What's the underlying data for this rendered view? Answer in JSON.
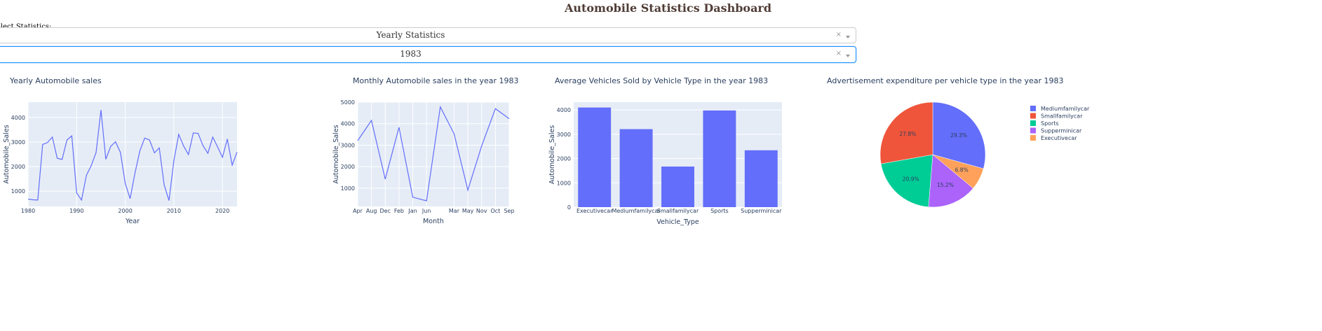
{
  "header": {
    "title": "Automobile Statistics Dashboard"
  },
  "controls": {
    "select_label": "elect Statistics:",
    "stat_dropdown": {
      "value": "Yearly Statistics",
      "clear": "×"
    },
    "year_dropdown": {
      "value": "1983",
      "clear": "×"
    }
  },
  "chart_data": [
    {
      "type": "line",
      "title": "Yearly Automobile sales",
      "xlabel": "Year",
      "ylabel": "Automobile_Sales",
      "xlim": [
        1980,
        2023
      ],
      "ylim": [
        380,
        4620
      ],
      "xticks": [
        "1980",
        "1990",
        "2000",
        "2010",
        "2020"
      ],
      "yticks": [
        "1000",
        "2000",
        "3000",
        "4000"
      ],
      "x": [
        1980,
        1981,
        1982,
        1983,
        1984,
        1985,
        1986,
        1987,
        1988,
        1989,
        1990,
        1991,
        1992,
        1993,
        1994,
        1995,
        1996,
        1997,
        1998,
        1999,
        2000,
        2001,
        2002,
        2003,
        2004,
        2005,
        2006,
        2007,
        2008,
        2009,
        2010,
        2011,
        2012,
        2013,
        2014,
        2015,
        2016,
        2017,
        2018,
        2019,
        2020,
        2021,
        2022,
        2023
      ],
      "values": [
        680,
        650,
        640,
        2900,
        2980,
        3200,
        2340,
        2290,
        3080,
        3250,
        930,
        640,
        1640,
        2040,
        2580,
        4300,
        2300,
        2820,
        3010,
        2580,
        1310,
        700,
        1740,
        2640,
        3160,
        3080,
        2560,
        2760,
        1260,
        620,
        2240,
        3310,
        2840,
        2490,
        3370,
        3350,
        2850,
        2540,
        3200,
        2800,
        2380,
        3120,
        2060,
        2590
      ]
    },
    {
      "type": "line",
      "title": "Monthly Automobile sales in the year 1983",
      "xlabel": "Month",
      "ylabel": "Automobile_Sales",
      "categories": [
        "Apr",
        "Aug",
        "Dec",
        "Feb",
        "Jan",
        "Jun",
        "Mar",
        "May",
        "Nov",
        "Oct",
        "Sep"
      ],
      "ylim": [
        150,
        5000
      ],
      "yticks": [
        "1000",
        "2000",
        "3000",
        "4000",
        "5000"
      ],
      "values": [
        3210,
        4150,
        1420,
        3830,
        580,
        410,
        4780,
        3530,
        910,
        2960,
        4700,
        4230
      ]
    },
    {
      "type": "bar",
      "title": "Average Vehicles Sold by Vehicle Type in the year 1983",
      "xlabel": "Vehicle_Type",
      "ylabel": "Automobile_Sales",
      "categories": [
        "Executivecar",
        "Mediumfamilycar",
        "Smallfamilycar",
        "Sports",
        "Supperminicar"
      ],
      "values": [
        4100,
        3210,
        1670,
        3980,
        2340
      ],
      "ylim": [
        0,
        4320
      ],
      "yticks": [
        "0",
        "1000",
        "2000",
        "3000",
        "4000"
      ]
    },
    {
      "type": "pie",
      "title": "Advertisement expenditure per vehicle type in the year 1983",
      "legend_position": "right",
      "slices": [
        {
          "name": "Mediumfamilycar",
          "value": 29.3,
          "label": "29.3%",
          "color": "#636efa"
        },
        {
          "name": "Smallfamilycar",
          "value": 27.8,
          "label": "27.8%",
          "color": "#ef553b"
        },
        {
          "name": "Sports",
          "value": 20.9,
          "label": "20.9%",
          "color": "#00cc96"
        },
        {
          "name": "Supperminicar",
          "value": 15.2,
          "label": "15.2%",
          "color": "#ab63fa"
        },
        {
          "name": "Executivecar",
          "value": 6.8,
          "label": "6.8%",
          "color": "#ffa15a"
        }
      ],
      "order": [
        "Mediumfamilycar",
        "Executivecar",
        "Supperminicar",
        "Sports",
        "Smallfamilycar"
      ]
    }
  ],
  "colors": {
    "line": "#636efa",
    "bar": "#636efa",
    "plot_bg": "#e5ecf6",
    "grid": "#ffffff",
    "title": "#503d36"
  }
}
